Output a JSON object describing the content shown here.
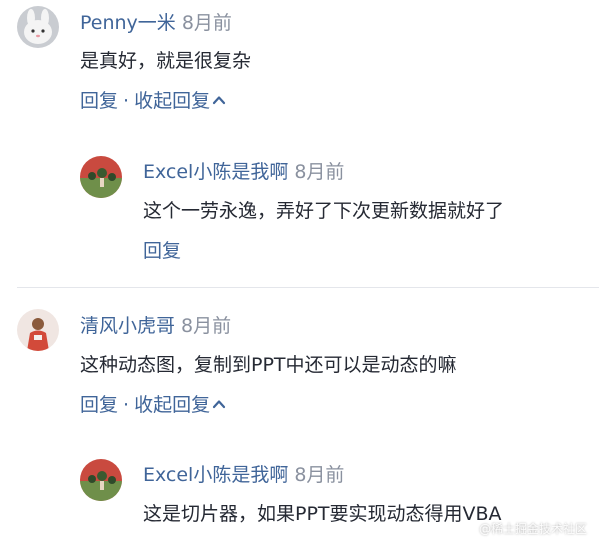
{
  "comments": [
    {
      "author": "Penny一米",
      "time": "8月前",
      "text": "是真好，就是很复杂",
      "reply_label": "回复",
      "separator": "·",
      "collapse_label": "收起回复",
      "reply": {
        "author": "Excel小陈是我啊",
        "time": "8月前",
        "text": "这个一劳永逸，弄好了下次更新数据就好了",
        "reply_label": "回复"
      }
    },
    {
      "author": "清风小虎哥",
      "time": "8月前",
      "text": "这种动态图，复制到PPT中还可以是动态的嘛",
      "reply_label": "回复",
      "separator": "·",
      "collapse_label": "收起回复",
      "reply": {
        "author": "Excel小陈是我啊",
        "time": "8月前",
        "text": "这是切片器，如果PPT要实现动态得用VBA"
      }
    }
  ],
  "watermark": "@稀土掘金技术社区",
  "colors": {
    "author": "#406599",
    "time": "#8a919f",
    "text": "#252933",
    "divider": "#e4e6eb"
  }
}
